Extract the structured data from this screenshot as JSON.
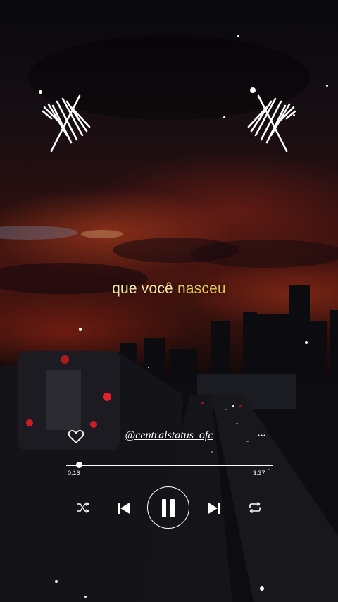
{
  "lyric": {
    "part1": "que você ",
    "part2": "nasceu"
  },
  "player": {
    "username": "@centralstatus_ofc",
    "current_time": "0:16",
    "total_time": "3:37",
    "progress_fraction": 0.06,
    "more_label": "•••"
  },
  "colors": {
    "lyric": "#f3e7a6",
    "lyric_accent": "#e8c84a",
    "controls": "#ffffff"
  },
  "icons": [
    "heart-icon",
    "more-icon",
    "shuffle-icon",
    "previous-icon",
    "pause-icon",
    "next-icon",
    "repeat-icon",
    "sound-wave-icon"
  ]
}
